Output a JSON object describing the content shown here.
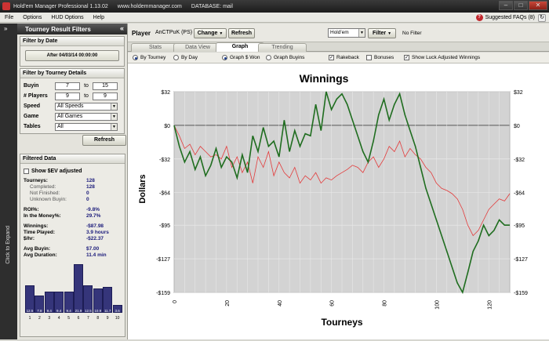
{
  "titlebar": {
    "app": "Hold'em Manager Professional 1.13.02",
    "url": "www.holdemmanager.com",
    "db": "DATABASE: mail"
  },
  "menu": [
    "File",
    "Options",
    "HUD Options",
    "Help"
  ],
  "faq": "Suggested FAQs (8)",
  "expand": {
    "label": "Click to Expand",
    "arrow": "»"
  },
  "leftpanel": {
    "title": "Tourney Result Filters",
    "collapse": "«",
    "date_group": "Filter by Date",
    "date_button": "After 04/03/14 00:00:00",
    "details_group": "Filter by Tourney Details",
    "buyin_label": "Buyin",
    "buyin_from": "7",
    "buyin_to": "15",
    "players_label": "# Players",
    "players_from": "9",
    "players_to": "9",
    "to_label": "to",
    "speed_label": "Speed",
    "speed_value": "All Speeds",
    "game_label": "Game",
    "game_value": "All Games",
    "tables_label": "Tables",
    "tables_value": "All",
    "refresh": "Refresh"
  },
  "filtered": {
    "title": "Filtered Data",
    "show_ev": "Show $EV adjusted",
    "stats": [
      {
        "k": "Tourneys:",
        "v": "128",
        "indent": false
      },
      {
        "k": "Completed:",
        "v": "128",
        "indent": true
      },
      {
        "k": "Not Finished:",
        "v": "0",
        "indent": true
      },
      {
        "k": "Unknown Buyin:",
        "v": "0",
        "indent": true
      },
      {
        "gap": true
      },
      {
        "k": "ROI%:",
        "v": "-9.8%",
        "indent": false
      },
      {
        "k": "In the Money%:",
        "v": "29.7%",
        "indent": false
      },
      {
        "gap": true
      },
      {
        "k": "Winnings:",
        "v": "-$87.98",
        "indent": false
      },
      {
        "k": "Time Played:",
        "v": "3.9 hours",
        "indent": false
      },
      {
        "k": "$/hr:",
        "v": "-$22.37",
        "indent": false
      },
      {
        "gap": true
      },
      {
        "k": "Avg Buyin:",
        "v": "$7.00",
        "indent": false
      },
      {
        "k": "Avg Duration:",
        "v": "11.4 min",
        "indent": false
      }
    ],
    "histogram": {
      "labels": [
        "12.5",
        "7.8",
        "9.4",
        "9.4",
        "9.4",
        "21.9",
        "12.5",
        "10.9",
        "11.7",
        "3.6"
      ],
      "values": [
        12.5,
        7.8,
        9.4,
        9.4,
        9.4,
        21.9,
        12.5,
        10.9,
        11.7,
        3.6
      ],
      "x": [
        "1",
        "2",
        "3",
        "4",
        "5",
        "6",
        "7",
        "8",
        "9",
        "10"
      ]
    }
  },
  "toolbar": {
    "player_label": "Player",
    "player_name": "AnCTPuK (PS)",
    "change": "Change",
    "refresh": "Refresh",
    "game_select": "Hold'em",
    "filter": "Filter",
    "no_filter": "No Filter"
  },
  "tabs": [
    "Stats",
    "Data View",
    "Graph",
    "Trending"
  ],
  "active_tab": "Graph",
  "options": {
    "by_tourney": "By Tourney",
    "by_day": "By Day",
    "graph_won": "Graph $ Won",
    "graph_buyins": "Graph Buyins",
    "rakeback": "Rakeback",
    "bonuses": "Bonuses",
    "luck_adjusted": "Show Luck Adjusted Winnings"
  },
  "colors": {
    "won_line": "#1f6d1f",
    "luck_line": "#e33b3b",
    "plot_bg": "#d3d3d3",
    "bar": "#35357a"
  },
  "chart_data": {
    "type": "line",
    "title": "Winnings",
    "xlabel": "Tourneys",
    "ylabel": "Dollars",
    "xlim": [
      0,
      128
    ],
    "ylim": [
      -159,
      32
    ],
    "xticks": [
      "0",
      "20",
      "40",
      "60",
      "80",
      "100",
      "120"
    ],
    "yticks": [
      "$32",
      "$0",
      "-$32",
      "-$64",
      "-$95",
      "-$127",
      "-$159"
    ],
    "grid": true,
    "series": [
      {
        "name": "Won",
        "color": "#1f6d1f",
        "x": [
          0,
          2,
          4,
          6,
          8,
          10,
          12,
          14,
          16,
          18,
          20,
          22,
          24,
          26,
          28,
          30,
          32,
          34,
          36,
          38,
          40,
          42,
          44,
          46,
          48,
          50,
          52,
          54,
          56,
          58,
          60,
          62,
          64,
          66,
          68,
          70,
          72,
          74,
          76,
          78,
          80,
          82,
          84,
          86,
          88,
          90,
          92,
          94,
          96,
          98,
          100,
          102,
          104,
          106,
          108,
          110,
          112,
          114,
          116,
          118,
          120,
          122,
          124,
          126,
          128
        ],
        "y": [
          0,
          -20,
          -35,
          -25,
          -42,
          -30,
          -48,
          -38,
          -22,
          -40,
          -30,
          -35,
          -50,
          -28,
          -45,
          -10,
          -25,
          -2,
          -20,
          -15,
          -30,
          5,
          -25,
          -5,
          -20,
          -8,
          -10,
          20,
          -5,
          32,
          15,
          25,
          30,
          20,
          5,
          -10,
          -25,
          -35,
          -15,
          10,
          25,
          5,
          20,
          30,
          10,
          -5,
          -20,
          -40,
          -60,
          -75,
          -90,
          -105,
          -120,
          -135,
          -150,
          -159,
          -140,
          -120,
          -110,
          -95,
          -105,
          -100,
          -90,
          -95,
          -95
        ]
      },
      {
        "name": "Luck Adjusted",
        "color": "#e33b3b",
        "x": [
          0,
          2,
          4,
          6,
          8,
          10,
          12,
          14,
          16,
          18,
          20,
          22,
          24,
          26,
          28,
          30,
          32,
          34,
          36,
          38,
          40,
          42,
          44,
          46,
          48,
          50,
          52,
          54,
          56,
          58,
          60,
          62,
          64,
          66,
          68,
          70,
          72,
          74,
          76,
          78,
          80,
          82,
          84,
          86,
          88,
          90,
          92,
          94,
          96,
          98,
          100,
          102,
          104,
          106,
          108,
          110,
          112,
          114,
          116,
          118,
          120,
          122,
          124,
          126,
          128
        ],
        "y": [
          0,
          -10,
          -22,
          -18,
          -28,
          -20,
          -25,
          -30,
          -28,
          -32,
          -20,
          -40,
          -30,
          -45,
          -35,
          -55,
          -30,
          -40,
          -25,
          -48,
          -35,
          -45,
          -50,
          -40,
          -55,
          -48,
          -52,
          -45,
          -55,
          -50,
          -52,
          -48,
          -45,
          -42,
          -38,
          -40,
          -45,
          -35,
          -30,
          -40,
          -32,
          -20,
          -25,
          -15,
          -30,
          -22,
          -28,
          -32,
          -40,
          -45,
          -55,
          -60,
          -62,
          -65,
          -70,
          -80,
          -95,
          -105,
          -100,
          -90,
          -80,
          -75,
          -70,
          -72,
          -65
        ]
      }
    ]
  }
}
